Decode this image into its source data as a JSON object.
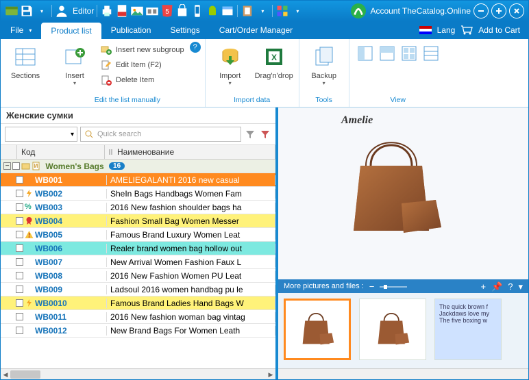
{
  "titlebar": {
    "editor": "Editor",
    "account": "Account TheCatalog.Online"
  },
  "menu": {
    "file": "File",
    "product": "Product list",
    "publication": "Publication",
    "settings": "Settings",
    "cartorder": "Cart/Order Manager",
    "lang": "Lang",
    "addcart": "Add to Cart"
  },
  "ribbon": {
    "sections": "Sections",
    "insert": "Insert",
    "insert_sub": "Insert new subgroup",
    "edit_item": "Edit Item  (F2)",
    "delete_item": "Delete Item",
    "edit_manual": "Edit the list manually",
    "import": "Import",
    "dragdrop": "Drag'n'drop",
    "import_data": "Import data",
    "backup": "Backup",
    "tools": "Tools",
    "view": "View"
  },
  "left": {
    "title": "Женские сумки",
    "search_ph": "Quick search",
    "col_code": "Код",
    "col_name": "Наименование",
    "group": "Women's Bags",
    "group_count": "16",
    "rows": [
      {
        "code": "WB001",
        "name": "AMELIEGALANTI 2016 new casual",
        "sel": true
      },
      {
        "code": "WB002",
        "name": "SheIn Bags Handbags Women Fam",
        "icon": "bolt"
      },
      {
        "code": "WB003",
        "name": "2016 New fashion shoulder bags ha",
        "icon": "pct"
      },
      {
        "code": "WB004",
        "name": "Fashion Small Bag Women Messer",
        "cls": "r-yellow",
        "icon": "rosette"
      },
      {
        "code": "WB005",
        "name": "Famous Brand Luxury Women Leat",
        "icon": "warn"
      },
      {
        "code": "WB006",
        "name": "Realer brand women bag hollow out",
        "cls": "r-cyan"
      },
      {
        "code": "WB007",
        "name": "New Arrival Women Fashion Faux L"
      },
      {
        "code": "WB008",
        "name": "2016 New Fashion Women PU Leat"
      },
      {
        "code": "WB009",
        "name": "Ladsoul 2016 women handbag pu le"
      },
      {
        "code": "WB0010",
        "name": "Famous Brand Ladies Hand Bags W",
        "cls": "r-yellow",
        "icon": "bolt"
      },
      {
        "code": "WB0011",
        "name": "2016 New fashion woman bag vintag"
      },
      {
        "code": "WB0012",
        "name": "New Brand Bags For Women Leath"
      }
    ]
  },
  "right": {
    "brand": "Amelie",
    "strip_title": "More pictures and files :",
    "note": "The quick brown f\nJackdaws love my\nThe five boxing w"
  }
}
